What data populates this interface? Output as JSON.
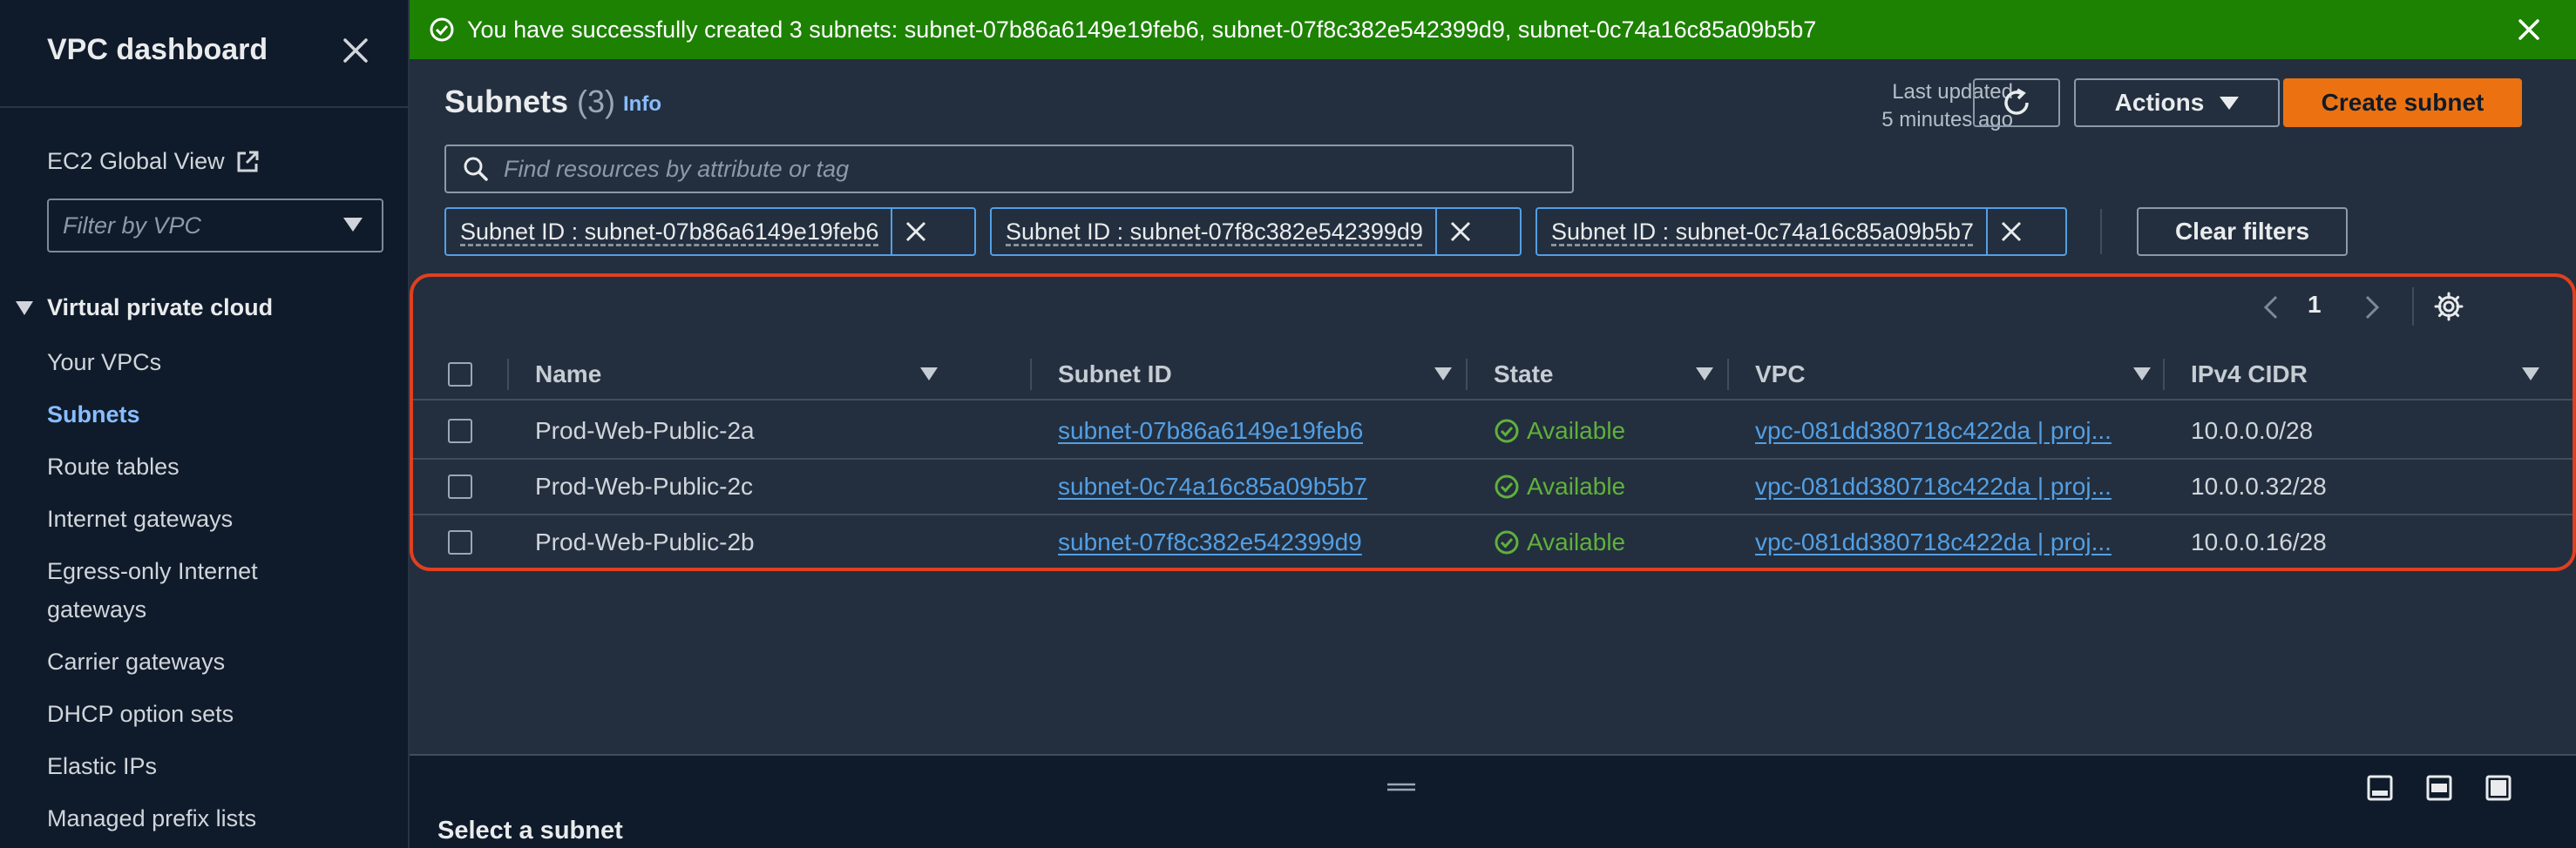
{
  "sidebar": {
    "title": "VPC dashboard",
    "global_view": "EC2 Global View",
    "filter_placeholder": "Filter by VPC",
    "section": "Virtual private cloud",
    "items": [
      {
        "label": "Your VPCs",
        "active": false
      },
      {
        "label": "Subnets",
        "active": true
      },
      {
        "label": "Route tables",
        "active": false
      },
      {
        "label": "Internet gateways",
        "active": false
      },
      {
        "label": "Egress-only Internet gateways",
        "active": false
      },
      {
        "label": "Carrier gateways",
        "active": false
      },
      {
        "label": "DHCP option sets",
        "active": false
      },
      {
        "label": "Elastic IPs",
        "active": false
      },
      {
        "label": "Managed prefix lists",
        "active": false
      }
    ]
  },
  "flash": {
    "message": "You have successfully created 3 subnets: subnet-07b86a6149e19feb6, subnet-07f8c382e542399d9, subnet-0c74a16c85a09b5b7",
    "color": "#1d8102"
  },
  "header": {
    "title": "Subnets",
    "count": "(3)",
    "info": "Info",
    "last_updated_label": "Last updated",
    "last_updated_value": "5 minutes ago",
    "actions_label": "Actions",
    "create_label": "Create subnet"
  },
  "search": {
    "placeholder": "Find resources by attribute or tag"
  },
  "filters": [
    "Subnet ID : subnet-07b86a6149e19feb6",
    "Subnet ID : subnet-07f8c382e542399d9",
    "Subnet ID : subnet-0c74a16c85a09b5b7"
  ],
  "clear_filters": "Clear filters",
  "pagination": {
    "page": "1"
  },
  "table": {
    "columns": [
      "Name",
      "Subnet ID",
      "State",
      "VPC",
      "IPv4 CIDR"
    ],
    "rows": [
      {
        "name": "Prod-Web-Public-2a",
        "subnet_id": "subnet-07b86a6149e19feb6",
        "state": "Available",
        "vpc": "vpc-081dd380718c422da | proj...",
        "cidr": "10.0.0.0/28"
      },
      {
        "name": "Prod-Web-Public-2c",
        "subnet_id": "subnet-0c74a16c85a09b5b7",
        "state": "Available",
        "vpc": "vpc-081dd380718c422da | proj...",
        "cidr": "10.0.0.32/28"
      },
      {
        "name": "Prod-Web-Public-2b",
        "subnet_id": "subnet-07f8c382e542399d9",
        "state": "Available",
        "vpc": "vpc-081dd380718c422da | proj...",
        "cidr": "10.0.0.16/28"
      }
    ]
  },
  "split_panel": {
    "title": "Select a subnet"
  },
  "colors": {
    "accent": "#ec7211",
    "link": "#539fe5",
    "success": "#5fb13c",
    "highlight": "#e0401f"
  }
}
